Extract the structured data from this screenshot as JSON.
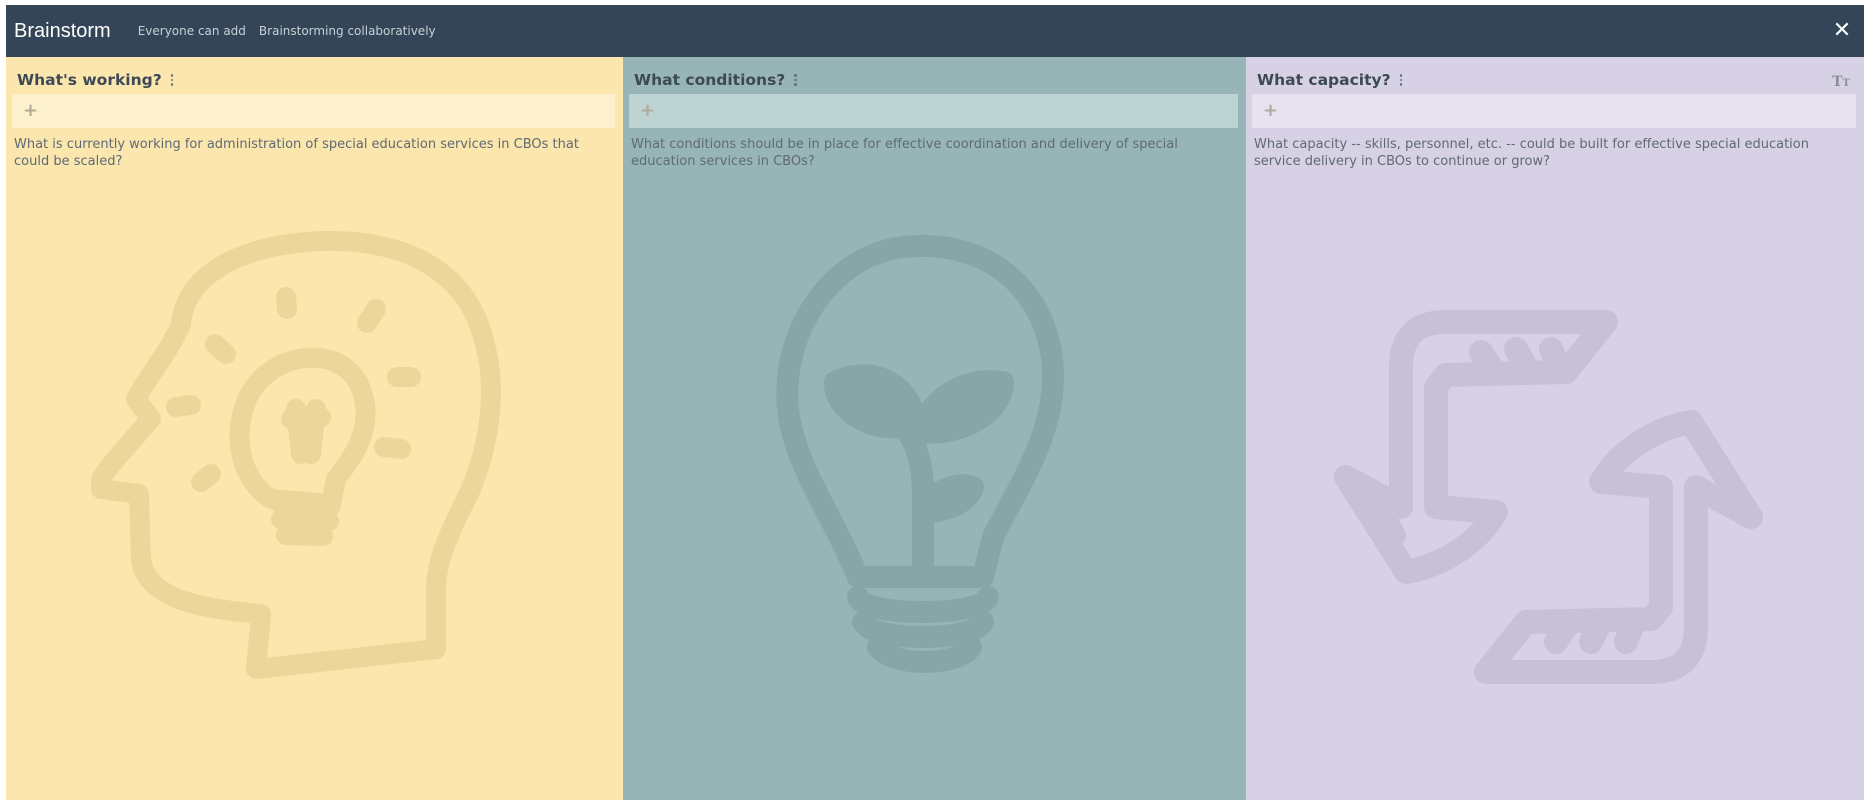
{
  "topbar": {
    "title": "Brainstorm",
    "meta_permission": "Everyone can add",
    "meta_mode": "Brainstorming collaboratively",
    "close_icon": "close-icon"
  },
  "columns": [
    {
      "title": "What's working?",
      "description": "What is currently working for administration of special education services in CBOs that could be scaled?",
      "background_color": "#fbe6ae",
      "add_bar_color": "#fdf0cc",
      "illustration": "head-with-lightbulb-icon"
    },
    {
      "title": "What conditions?",
      "description": "What conditions should be in place for effective coordination and delivery of special education services in CBOs?",
      "background_color": "#97b5b6",
      "add_bar_color": "#bcd3d1",
      "illustration": "lightbulb-with-sprout-icon"
    },
    {
      "title": "What capacity?",
      "description": "What capacity -- skills, personnel, etc. -- could be built for effective special education service delivery in CBOs to continue or grow?",
      "background_color": "#d7d1e6",
      "add_bar_color": "#e6e2f0",
      "illustration": "cycle-arrows-icon",
      "text_size_icon": "text-size-icon"
    }
  ],
  "colors": {
    "topbar": "#334556",
    "title_text": "#3d4a56"
  }
}
